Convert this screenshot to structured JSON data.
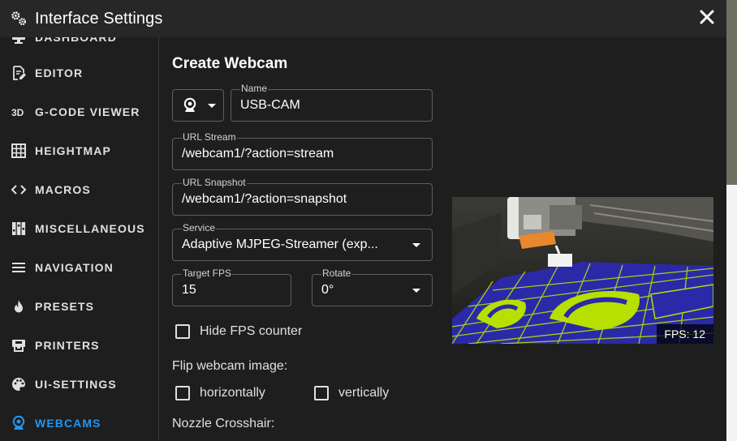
{
  "dialog": {
    "title": "Interface Settings"
  },
  "sidebar": {
    "items": [
      {
        "label": "DASHBOARD",
        "icon": "monitor-icon",
        "active": false
      },
      {
        "label": "EDITOR",
        "icon": "file-edit-icon",
        "active": false
      },
      {
        "label": "G-CODE VIEWER",
        "icon": "3d-icon",
        "active": false
      },
      {
        "label": "HEIGHTMAP",
        "icon": "grid-icon",
        "active": false
      },
      {
        "label": "MACROS",
        "icon": "code-icon",
        "active": false
      },
      {
        "label": "MISCELLANEOUS",
        "icon": "sliders-icon",
        "active": false
      },
      {
        "label": "NAVIGATION",
        "icon": "menu-icon",
        "active": false
      },
      {
        "label": "PRESETS",
        "icon": "fire-icon",
        "active": false
      },
      {
        "label": "PRINTERS",
        "icon": "printer-icon",
        "active": false
      },
      {
        "label": "UI-SETTINGS",
        "icon": "palette-icon",
        "active": false
      },
      {
        "label": "WEBCAMS",
        "icon": "webcam-icon",
        "active": true
      }
    ]
  },
  "form": {
    "heading": "Create Webcam",
    "icon_select": {
      "icon": "webcam-icon"
    },
    "name": {
      "label": "Name",
      "value": "USB-CAM"
    },
    "url_stream": {
      "label": "URL Stream",
      "value": "/webcam1/?action=stream"
    },
    "url_snapshot": {
      "label": "URL Snapshot",
      "value": "/webcam1/?action=snapshot"
    },
    "service": {
      "label": "Service",
      "value": "Adaptive MJPEG-Streamer (exp..."
    },
    "target_fps": {
      "label": "Target FPS",
      "value": "15"
    },
    "rotate": {
      "label": "Rotate",
      "value": "0°"
    },
    "hide_fps": {
      "label": "Hide FPS counter",
      "checked": false
    },
    "flip_label": "Flip webcam image:",
    "flip_h": {
      "label": "horizontally",
      "checked": false
    },
    "flip_v": {
      "label": "vertically",
      "checked": false
    },
    "nozzle_label": "Nozzle Crosshair:"
  },
  "preview": {
    "fps_text": "FPS: 12"
  },
  "colors": {
    "accent": "#2196f3",
    "background": "#1e1e1e",
    "titlebar": "#272727",
    "bed_blue": "#2a2aa8",
    "bed_grid": "#b7e000",
    "toolhead_orange": "#e8872c"
  }
}
